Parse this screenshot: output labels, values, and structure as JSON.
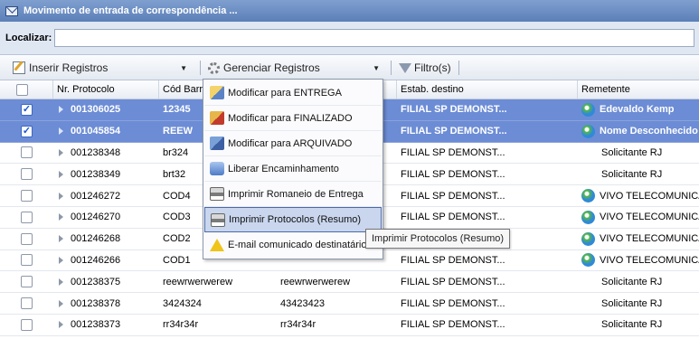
{
  "window": {
    "title": "Movimento de entrada de correspondência ..."
  },
  "search": {
    "label": "Localizar:",
    "value": ""
  },
  "toolbar": {
    "insert_label": "Inserir Registros",
    "manage_label": "Gerenciar Registros",
    "filter_label": "Filtro(s)"
  },
  "columns": [
    "Nr. Protocolo",
    "Cód Barras",
    "",
    "Estab. destino",
    "Remetente"
  ],
  "rows": [
    {
      "checked": true,
      "selected": true,
      "protocolo": "001306025",
      "cod": "12345",
      "col3": "",
      "estab": "FILIAL SP DEMONST...",
      "remetente": "Edevaldo Kemp",
      "icon": true
    },
    {
      "checked": true,
      "selected": true,
      "protocolo": "001045854",
      "cod": "REEW",
      "col3": "",
      "estab": "FILIAL SP DEMONST...",
      "remetente": "Nome Desconhecido",
      "icon": true
    },
    {
      "checked": false,
      "selected": false,
      "protocolo": "001238348",
      "cod": "br324",
      "col3": "",
      "estab": "FILIAL SP DEMONST...",
      "remetente": "Solicitante RJ",
      "icon": false
    },
    {
      "checked": false,
      "selected": false,
      "protocolo": "001238349",
      "cod": "brt32",
      "col3": "",
      "estab": "FILIAL SP DEMONST...",
      "remetente": "Solicitante RJ",
      "icon": false
    },
    {
      "checked": false,
      "selected": false,
      "protocolo": "001246272",
      "cod": "COD4",
      "col3": "",
      "estab": "FILIAL SP DEMONST...",
      "remetente": "VIVO TELECOMUNICA",
      "icon": true
    },
    {
      "checked": false,
      "selected": false,
      "protocolo": "001246270",
      "cod": "COD3",
      "col3": "",
      "estab": "FILIAL SP DEMONST...",
      "remetente": "VIVO TELECOMUNICA",
      "icon": true
    },
    {
      "checked": false,
      "selected": false,
      "protocolo": "001246268",
      "cod": "COD2",
      "col3": "",
      "estab": "FILIAL SP DEMONST...",
      "remetente": "VIVO TELECOMUNICA",
      "icon": true
    },
    {
      "checked": false,
      "selected": false,
      "protocolo": "001246266",
      "cod": "COD1",
      "col3": "",
      "estab": "FILIAL SP DEMONST...",
      "remetente": "VIVO TELECOMUNICA",
      "icon": true
    },
    {
      "checked": false,
      "selected": false,
      "protocolo": "001238375",
      "cod": "reewrwerwerew",
      "col3": "reewrwerwerew",
      "estab": "FILIAL SP DEMONST...",
      "remetente": "Solicitante RJ",
      "icon": false
    },
    {
      "checked": false,
      "selected": false,
      "protocolo": "001238378",
      "cod": "3424324",
      "col3": "43423423",
      "estab": "FILIAL SP DEMONST...",
      "remetente": "Solicitante RJ",
      "icon": false
    },
    {
      "checked": false,
      "selected": false,
      "protocolo": "001238373",
      "cod": "rr34r34r",
      "col3": "rr34r34r",
      "estab": "FILIAL SP DEMONST...",
      "remetente": "Solicitante RJ",
      "icon": false
    }
  ],
  "menu": [
    {
      "label": "Modificar para ENTREGA",
      "icon": "delivery-icon"
    },
    {
      "label": "Modificar para FINALIZADO",
      "icon": "finalized-icon"
    },
    {
      "label": "Modificar para ARQUIVADO",
      "icon": "archive-icon"
    },
    {
      "label": "Liberar Encaminhamento",
      "icon": "forward-icon"
    },
    {
      "label": "Imprimir Romaneio de Entrega",
      "icon": "printer-icon"
    },
    {
      "label": "Imprimir Protocolos (Resumo)",
      "icon": "printer-icon",
      "highlighted": true
    },
    {
      "label": "E-mail comunicado destinatário",
      "icon": "warning-icon"
    }
  ],
  "tooltip": "Imprimir Protocolos (Resumo)"
}
